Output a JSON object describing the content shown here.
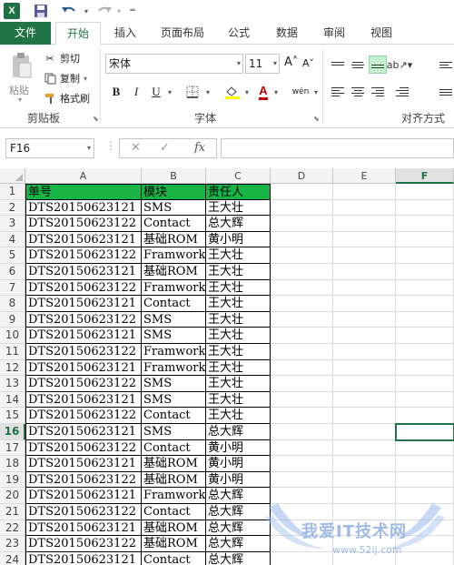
{
  "qat": {
    "logo": "X",
    "icons": [
      "excel-logo",
      "save-icon",
      "undo-icon",
      "redo-icon",
      "customize-icon"
    ]
  },
  "tabs": {
    "file": "文件",
    "home": "开始",
    "insert": "插入",
    "layout": "页面布局",
    "formulas": "公式",
    "data": "数据",
    "review": "审阅",
    "view": "视图"
  },
  "ribbon": {
    "paste_label": "粘贴",
    "cut": "剪切",
    "copy": "复制",
    "format_painter": "格式刷",
    "clipboard_group": "剪贴板",
    "font_name": "宋体",
    "font_size": "11",
    "grow_font": "A˄",
    "shrink_font": "A˅",
    "bold": "B",
    "italic": "I",
    "underline": "U",
    "font_color_letter": "A",
    "phonetic": "wén",
    "font_group": "字体",
    "align_group": "对齐方式",
    "accent_color": "#217346",
    "fill_color": "#ffff00",
    "font_color": "#c00000"
  },
  "formula_bar": {
    "name_box": "F16",
    "cancel_icon": "✕",
    "enter_icon": "✓",
    "fx": "fx",
    "formula": ""
  },
  "grid": {
    "columns": [
      "A",
      "B",
      "C",
      "D",
      "E",
      "F"
    ],
    "selected_column": "F",
    "selected_row": "16",
    "rows": [
      {
        "n": "1",
        "a": "单号",
        "b": "模块",
        "c": "责任人"
      },
      {
        "n": "2",
        "a": "DTS20150623121",
        "b": "SMS",
        "c": "王大壮"
      },
      {
        "n": "3",
        "a": "DTS20150623122",
        "b": "Contact",
        "c": "总大辉"
      },
      {
        "n": "4",
        "a": "DTS20150623121",
        "b": "基础ROM",
        "c": "黄小明"
      },
      {
        "n": "5",
        "a": "DTS20150623122",
        "b": "Framwork",
        "c": "王大壮"
      },
      {
        "n": "6",
        "a": "DTS20150623121",
        "b": "基础ROM",
        "c": "王大壮"
      },
      {
        "n": "7",
        "a": "DTS20150623122",
        "b": "Framwork",
        "c": "王大壮"
      },
      {
        "n": "8",
        "a": "DTS20150623121",
        "b": "Contact",
        "c": "王大壮"
      },
      {
        "n": "9",
        "a": "DTS20150623122",
        "b": "SMS",
        "c": "王大壮"
      },
      {
        "n": "10",
        "a": "DTS20150623121",
        "b": "SMS",
        "c": "王大壮"
      },
      {
        "n": "11",
        "a": "DTS20150623122",
        "b": "Framwork",
        "c": "王大壮"
      },
      {
        "n": "12",
        "a": "DTS20150623121",
        "b": "Framwork",
        "c": "王大壮"
      },
      {
        "n": "13",
        "a": "DTS20150623122",
        "b": "SMS",
        "c": "王大壮"
      },
      {
        "n": "14",
        "a": "DTS20150623121",
        "b": "SMS",
        "c": "王大壮"
      },
      {
        "n": "15",
        "a": "DTS20150623122",
        "b": "Contact",
        "c": "王大壮"
      },
      {
        "n": "16",
        "a": "DTS20150623121",
        "b": "SMS",
        "c": "总大辉"
      },
      {
        "n": "17",
        "a": "DTS20150623122",
        "b": "Contact",
        "c": "黄小明"
      },
      {
        "n": "18",
        "a": "DTS20150623121",
        "b": "基础ROM",
        "c": "黄小明"
      },
      {
        "n": "19",
        "a": "DTS20150623122",
        "b": "基础ROM",
        "c": "黄小明"
      },
      {
        "n": "20",
        "a": "DTS20150623121",
        "b": "Framwork",
        "c": "总大辉"
      },
      {
        "n": "21",
        "a": "DTS20150623122",
        "b": "Contact",
        "c": "总大辉"
      },
      {
        "n": "22",
        "a": "DTS20150623121",
        "b": "基础ROM",
        "c": "总大辉"
      },
      {
        "n": "23",
        "a": "DTS20150623122",
        "b": "基础ROM",
        "c": "总大辉"
      },
      {
        "n": "24",
        "a": "DTS20150623121",
        "b": "Contact",
        "c": "总大辉"
      }
    ],
    "header_fill": "#19b446",
    "selection_color": "#217346"
  },
  "watermark": {
    "text": "我爱IT技术网",
    "url": "www.52ij.com"
  }
}
